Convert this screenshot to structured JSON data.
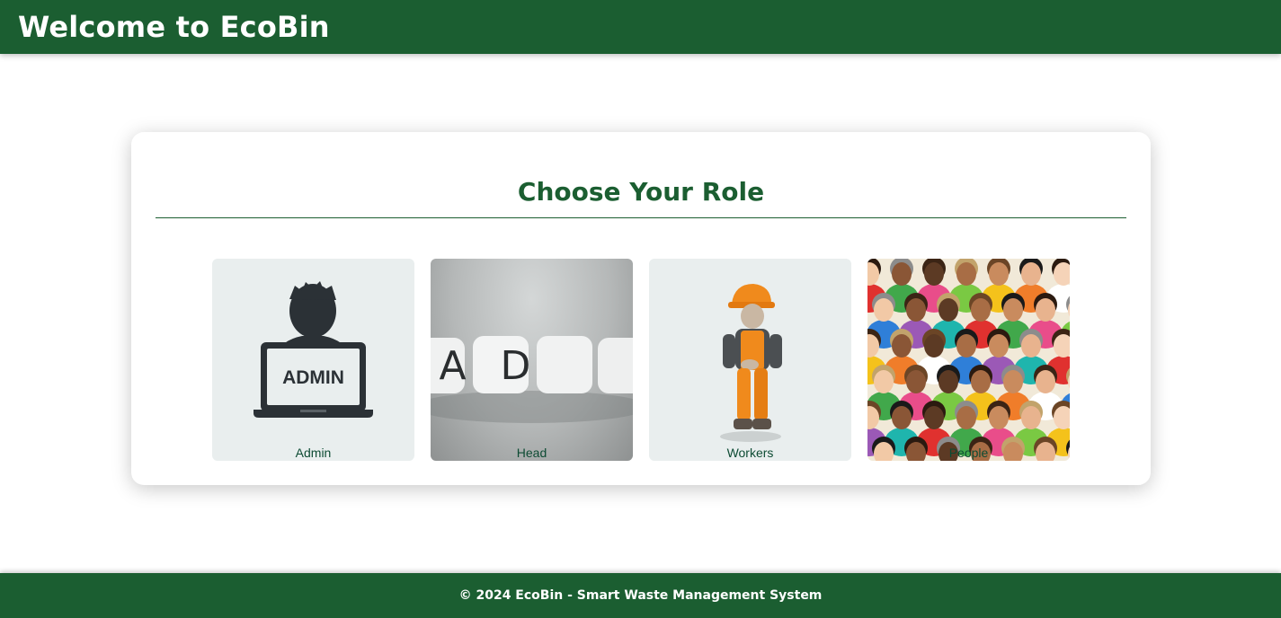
{
  "header": {
    "title": "Welcome to EcoBin"
  },
  "panel": {
    "title": "Choose Your Role"
  },
  "roles": [
    {
      "label": "Admin",
      "image_text": "ADMIN",
      "icon": "admin-laptop-icon"
    },
    {
      "label": "Head",
      "image_text": "HEAD",
      "icon": "head-letter-cubes-image"
    },
    {
      "label": "Workers",
      "icon": "construction-worker-image"
    },
    {
      "label": "People",
      "icon": "crowd-of-people-image"
    }
  ],
  "footer": {
    "text": "© 2024 EcoBin - Smart Waste Management System"
  },
  "colors": {
    "brand_green": "#1b5e31",
    "label_green": "#0d4b33",
    "tile_bg": "#e9eeee"
  }
}
